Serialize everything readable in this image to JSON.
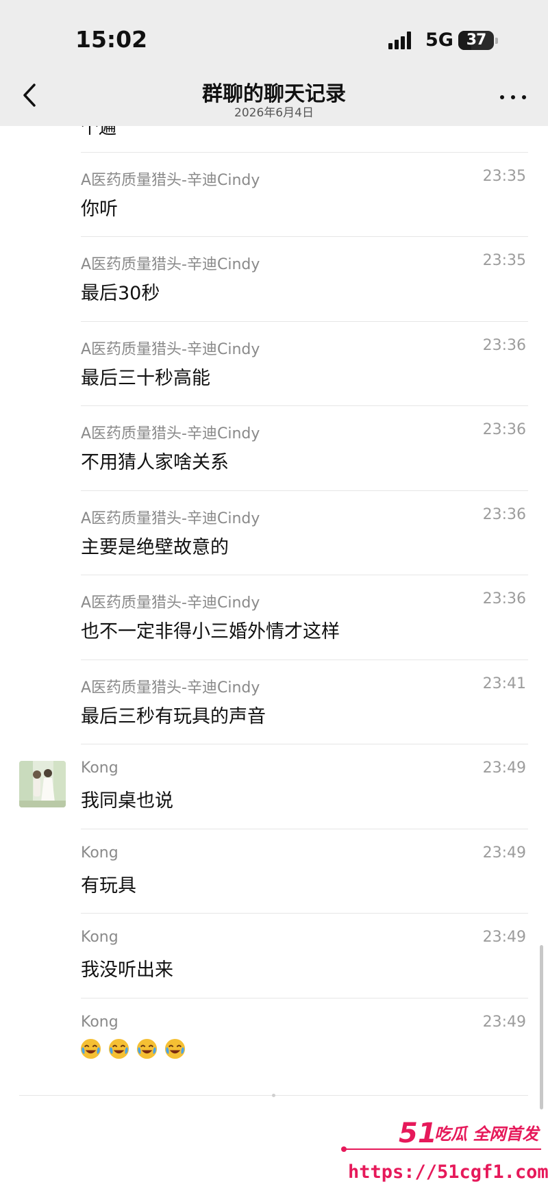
{
  "status_bar": {
    "time": "15:02",
    "network": "5G",
    "battery": "37",
    "battery_level": 0.37,
    "signal_icon": "cellular-signal-icon",
    "battery_icon": "battery-icon"
  },
  "nav": {
    "title": "群聊的聊天记录",
    "subtitle": "2026年6月4日",
    "back_icon": "chevron-left-icon",
    "more_icon": "more-horizontal-icon"
  },
  "cut_off_message": "个遍",
  "messages": [
    {
      "sender": "A医药质量猎头-辛迪Cindy",
      "time": "23:35",
      "text": "你听"
    },
    {
      "sender": "A医药质量猎头-辛迪Cindy",
      "time": "23:35",
      "text": "最后30秒"
    },
    {
      "sender": "A医药质量猎头-辛迪Cindy",
      "time": "23:36",
      "text": "最后三十秒高能"
    },
    {
      "sender": "A医药质量猎头-辛迪Cindy",
      "time": "23:36",
      "text": "不用猜人家啥关系"
    },
    {
      "sender": "A医药质量猎头-辛迪Cindy",
      "time": "23:36",
      "text": "主要是绝壁故意的"
    },
    {
      "sender": "A医药质量猎头-辛迪Cindy",
      "time": "23:36",
      "text": "也不一定非得小三婚外情才这样"
    },
    {
      "sender": "A医药质量猎头-辛迪Cindy",
      "time": "23:41",
      "text": "最后三秒有玩具的声音"
    },
    {
      "sender": "Kong",
      "time": "23:49",
      "text": "我同桌也说",
      "has_avatar": true
    },
    {
      "sender": "Kong",
      "time": "23:49",
      "text": "有玩具"
    },
    {
      "sender": "Kong",
      "time": "23:49",
      "text": "我没听出来"
    },
    {
      "sender": "Kong",
      "time": "23:49",
      "text": "",
      "emoji": [
        "laughing-crying-emoji",
        "laughing-crying-emoji",
        "laughing-crying-emoji",
        "laughing-crying-emoji"
      ]
    }
  ],
  "watermark": {
    "brand": "51",
    "tagline": "吃瓜 全网首发",
    "url": "https://51cgf1.com",
    "color": "#e6195a"
  }
}
